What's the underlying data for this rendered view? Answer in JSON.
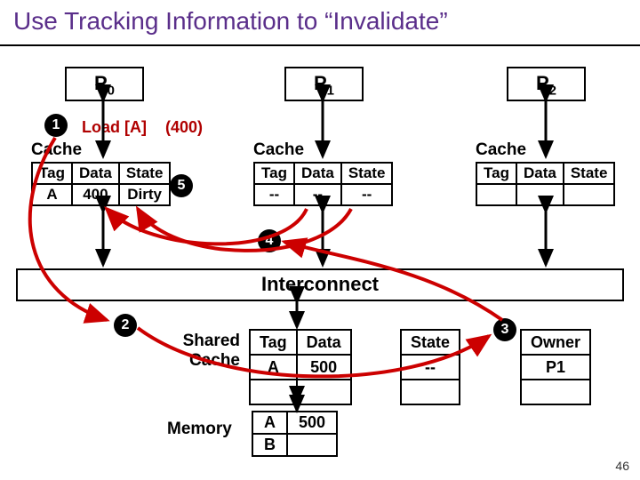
{
  "title": "Use Tracking Information to “Invalidate”",
  "slide_number": "46",
  "processors": {
    "p0": "P",
    "p0s": "0",
    "p1": "P",
    "p1s": "1",
    "p2": "P",
    "p2s": "2"
  },
  "cache": {
    "label0": "Cache",
    "label1": "Cache",
    "label2": "Cache",
    "hdr": {
      "tag": "Tag",
      "data": "Data",
      "state": "State"
    },
    "p0": {
      "tag": "A",
      "data": "400",
      "state": "Dirty"
    },
    "p1": {
      "tag": "--",
      "data": "--",
      "state": "--"
    },
    "p2": {
      "tag": "",
      "data": "",
      "state": ""
    }
  },
  "op": {
    "load": "Load [A]",
    "val": "(400)"
  },
  "steps": {
    "s1": "1",
    "s2": "2",
    "s3": "3",
    "s4": "4",
    "s5": "5"
  },
  "interconnect": "Interconnect",
  "shared_cache": {
    "label_l1": "Shared",
    "label_l2": "Cache",
    "hdr": {
      "tag": "Tag",
      "data": "Data",
      "state": "State",
      "owner": "Owner"
    },
    "row": {
      "tag": "A",
      "data": "500",
      "state": "--",
      "owner": "P1"
    }
  },
  "memory": {
    "label": "Memory",
    "r0": {
      "a": "A",
      "v": "500"
    },
    "r1": {
      "a": "B",
      "v": ""
    }
  }
}
